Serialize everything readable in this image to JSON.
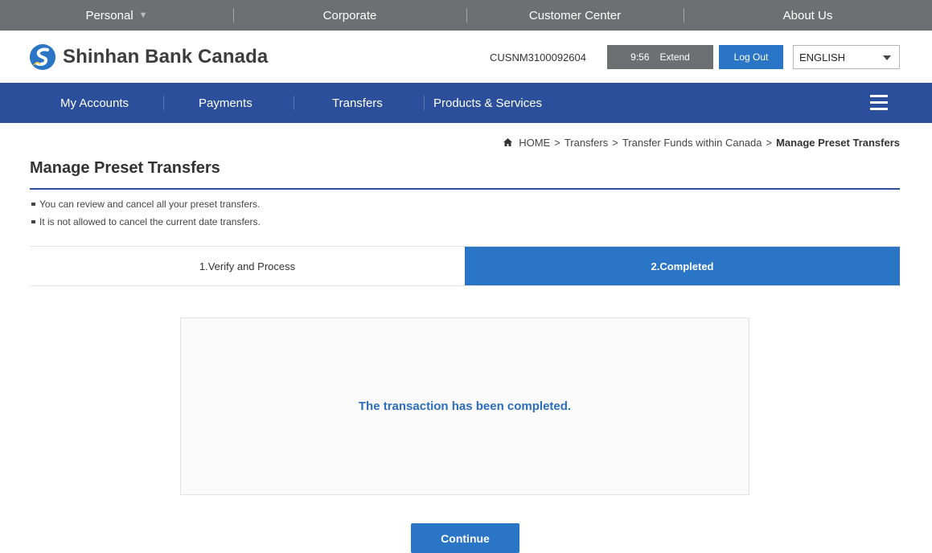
{
  "topbar": {
    "items": [
      {
        "label": "Personal"
      },
      {
        "label": "Corporate"
      },
      {
        "label": "Customer Center"
      },
      {
        "label": "About Us"
      }
    ]
  },
  "header": {
    "brand": "Shinhan Bank Canada",
    "user_id": "CUSNM3100092604",
    "session_time": "9:56",
    "extend_label": "Extend",
    "logout_label": "Log Out",
    "language": "ENGLISH"
  },
  "nav": {
    "items": [
      {
        "label": "My Accounts"
      },
      {
        "label": "Payments"
      },
      {
        "label": "Transfers"
      },
      {
        "label": "Products & Services"
      }
    ]
  },
  "breadcrumb": {
    "items": [
      "HOME",
      "Transfers",
      "Transfer Funds within Canada"
    ],
    "current": "Manage Preset Transfers",
    "separator": ">"
  },
  "page": {
    "title": "Manage Preset Transfers",
    "notes": [
      "You can review and cancel all your preset transfers.",
      "It is not allowed to cancel the current date transfers."
    ]
  },
  "steps": [
    {
      "label": "1.Verify and Process"
    },
    {
      "label": "2.Completed"
    }
  ],
  "result": {
    "message": "The transaction has been completed."
  },
  "actions": {
    "continue_label": "Continue"
  },
  "colors": {
    "topbar": "#6d6f73",
    "nav": "#2c4f9c",
    "accent": "#2a75c6"
  }
}
